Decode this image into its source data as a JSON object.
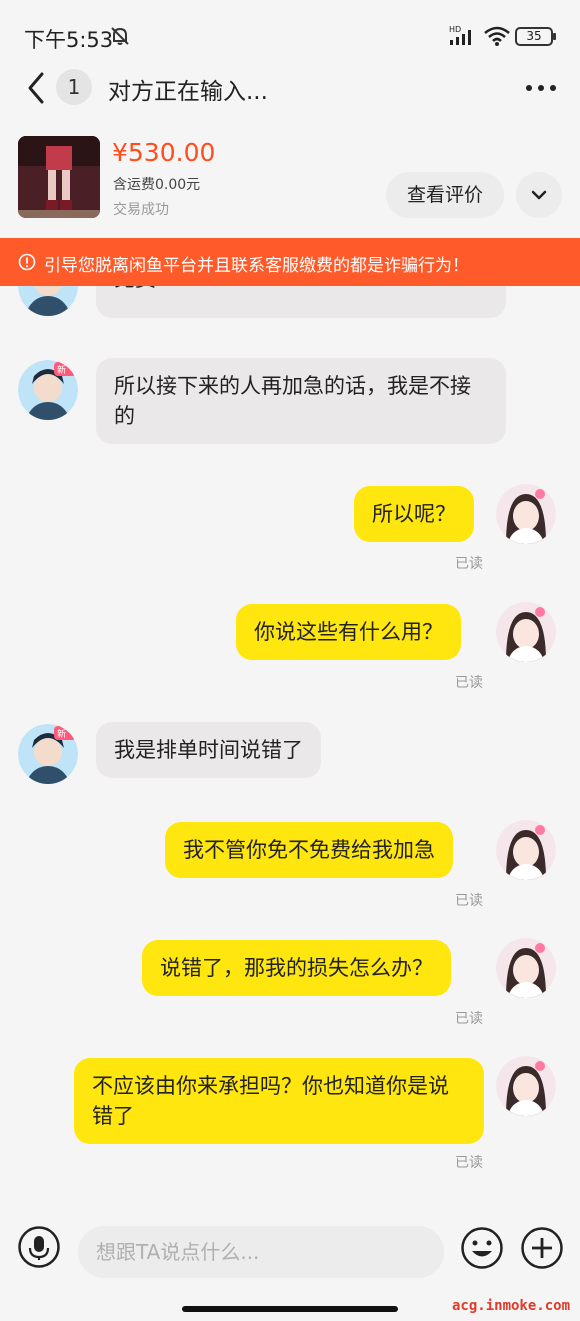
{
  "status_bar": {
    "time": "下午5:53",
    "battery": "35"
  },
  "header": {
    "unread_count": "1",
    "title": "对方正在输入..."
  },
  "product": {
    "price": "¥530.00",
    "shipping": "含运费0.00元",
    "status": "交易成功",
    "review_label": "查看评价"
  },
  "warning": {
    "text": "引导您脱离闲鱼平台并且联系客服缴费的都是诈骗行为！"
  },
  "messages": [
    {
      "sender": "other",
      "text": "免费"
    },
    {
      "sender": "other",
      "text": "所以接下来的人再加急的话，我是不接的"
    },
    {
      "sender": "me",
      "text": "所以呢？",
      "read": "已读"
    },
    {
      "sender": "me",
      "text": "你说这些有什么用？",
      "read": "已读"
    },
    {
      "sender": "other",
      "text": "我是排单时间说错了"
    },
    {
      "sender": "me",
      "text": "我不管你免不免费给我加急",
      "read": "已读"
    },
    {
      "sender": "me",
      "text": "说错了，那我的损失怎么办？",
      "read": "已读"
    },
    {
      "sender": "me",
      "text": "不应该由你来承担吗？你也知道你是说错了",
      "read": "已读"
    }
  ],
  "composer": {
    "placeholder": "想跟TA说点什么..."
  },
  "watermark": "acg.inmoke.com",
  "colors": {
    "accent_orange": "#ff5a2a",
    "price_red": "#ff4e1e",
    "my_bubble": "#ffe60f",
    "their_bubble": "#ebe8ea"
  }
}
